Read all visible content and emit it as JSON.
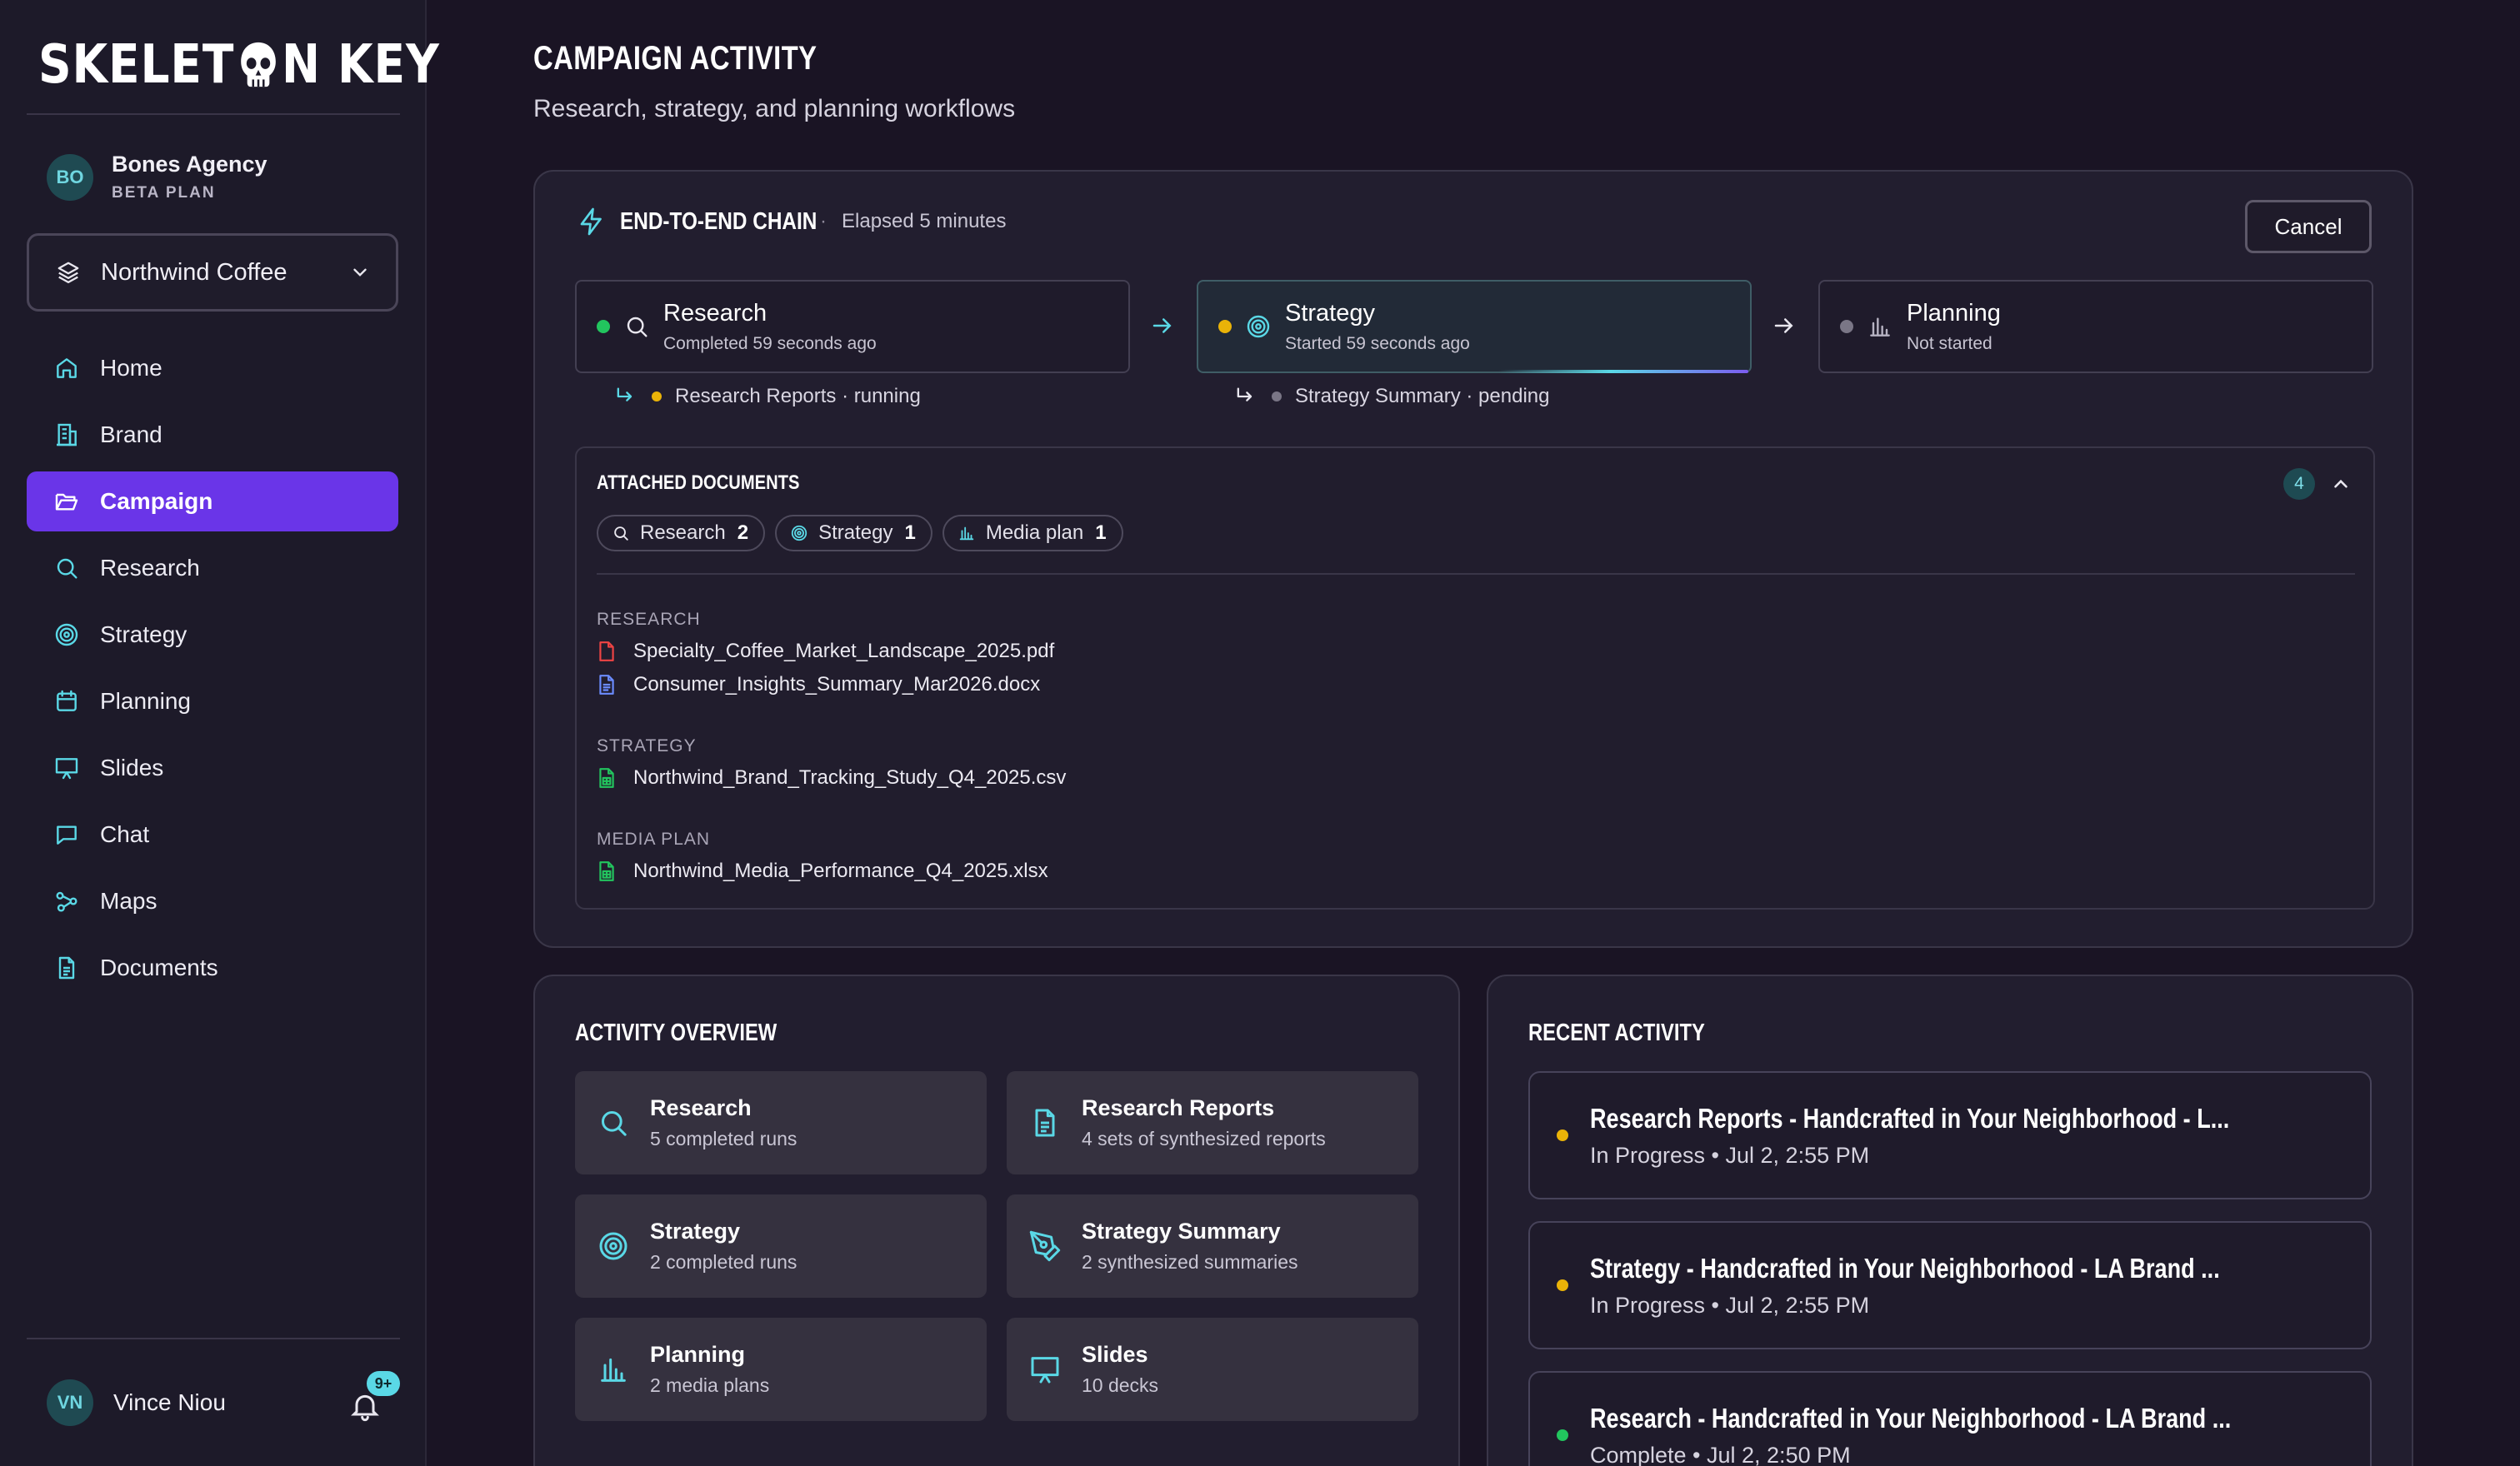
{
  "brand": {
    "logo_left": "SKELET",
    "logo_right": "N KEY"
  },
  "agency": {
    "initials": "BO",
    "name": "Bones Agency",
    "plan": "BETA PLAN"
  },
  "client_select": {
    "value": "Northwind Coffee"
  },
  "nav": [
    {
      "label": "Home",
      "icon": "home-icon"
    },
    {
      "label": "Brand",
      "icon": "building-icon"
    },
    {
      "label": "Campaign",
      "icon": "folder-open-icon",
      "active": true
    },
    {
      "label": "Research",
      "icon": "search-icon"
    },
    {
      "label": "Strategy",
      "icon": "target-icon"
    },
    {
      "label": "Planning",
      "icon": "calendar-icon"
    },
    {
      "label": "Slides",
      "icon": "presentation-icon"
    },
    {
      "label": "Chat",
      "icon": "chat-icon"
    },
    {
      "label": "Maps",
      "icon": "route-icon"
    },
    {
      "label": "Documents",
      "icon": "document-icon"
    }
  ],
  "user": {
    "initials": "VN",
    "name": "Vince Niou",
    "notifications": "9+"
  },
  "page": {
    "title": "CAMPAIGN ACTIVITY",
    "subtitle": "Research, strategy, and planning workflows"
  },
  "chain": {
    "title": "END-TO-END CHAIN",
    "separator": "·",
    "elapsed": "Elapsed 5 minutes",
    "cancel_label": "Cancel",
    "steps": [
      {
        "name": "Research",
        "status": "Completed 59 seconds ago",
        "dot_color": "#22c55e"
      },
      {
        "name": "Strategy",
        "status": "Started 59 seconds ago",
        "dot_color": "#eab308"
      },
      {
        "name": "Planning",
        "status": "Not started",
        "dot_color": "#7a7686"
      }
    ],
    "substeps": [
      {
        "text": "Research Reports · running",
        "dot_color": "#eab308"
      },
      {
        "text": "Strategy Summary · pending",
        "dot_color": "#7a7686"
      }
    ]
  },
  "documents": {
    "title": "ATTACHED DOCUMENTS",
    "count": "4",
    "chips": [
      {
        "label": "Research",
        "count": "2"
      },
      {
        "label": "Strategy",
        "count": "1"
      },
      {
        "label": "Media plan",
        "count": "1"
      }
    ],
    "groups": [
      {
        "label": "RESEARCH",
        "files": [
          "Specialty_Coffee_Market_Landscape_2025.pdf",
          "Consumer_Insights_Summary_Mar2026.docx"
        ]
      },
      {
        "label": "STRATEGY",
        "files": [
          "Northwind_Brand_Tracking_Study_Q4_2025.csv"
        ]
      },
      {
        "label": "MEDIA PLAN",
        "files": [
          "Northwind_Media_Performance_Q4_2025.xlsx"
        ]
      }
    ]
  },
  "overview": {
    "title": "ACTIVITY OVERVIEW",
    "cards": [
      {
        "name": "Research",
        "desc": "5 completed runs"
      },
      {
        "name": "Research Reports",
        "desc": "4 sets of synthesized reports"
      },
      {
        "name": "Strategy",
        "desc": "2 completed runs"
      },
      {
        "name": "Strategy Summary",
        "desc": "2 synthesized summaries"
      },
      {
        "name": "Planning",
        "desc": "2 media plans"
      },
      {
        "name": "Slides",
        "desc": "10 decks"
      }
    ]
  },
  "recent": {
    "title": "RECENT ACTIVITY",
    "items": [
      {
        "title": "Research Reports - Handcrafted in Your Neighborhood - L...",
        "meta": "In Progress • Jul 2, 2:55 PM",
        "dot_color": "#eab308"
      },
      {
        "title": "Strategy - Handcrafted in Your Neighborhood - LA Brand ...",
        "meta": "In Progress • Jul 2, 2:55 PM",
        "dot_color": "#eab308"
      },
      {
        "title": "Research - Handcrafted in Your Neighborhood - LA Brand ...",
        "meta": "Complete • Jul 2, 2:50 PM",
        "dot_color": "#22c55e"
      }
    ]
  },
  "colors": {
    "accent": "#6a35e8",
    "teal": "#5ad8e6",
    "background": "#1a1424"
  }
}
